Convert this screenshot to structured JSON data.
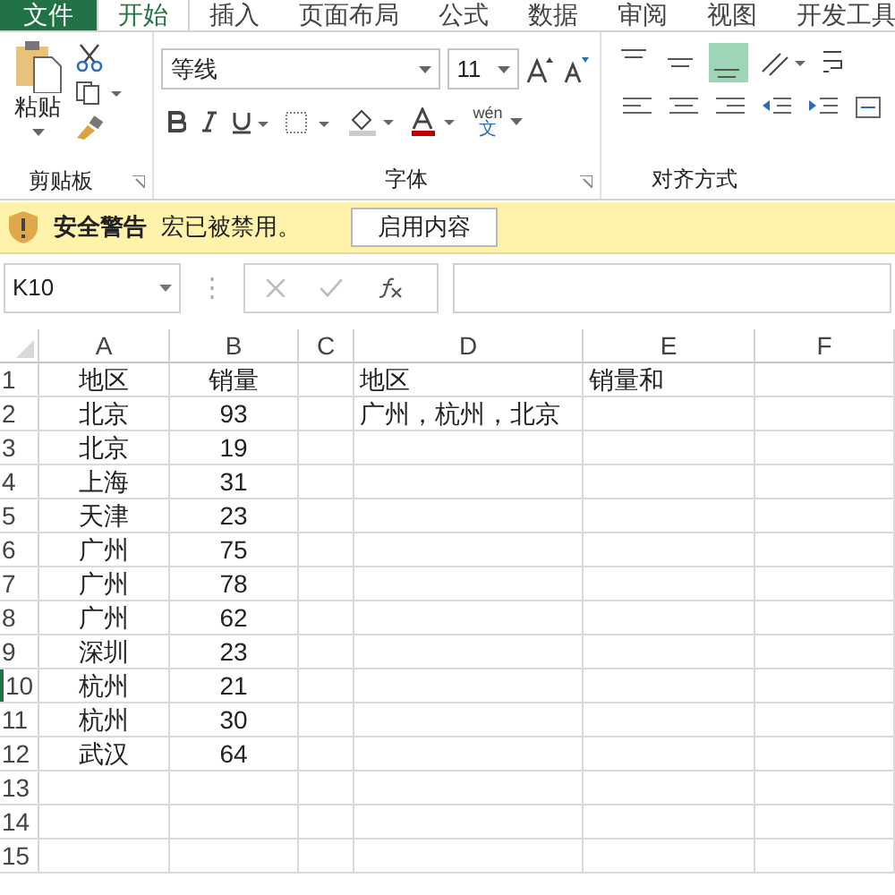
{
  "ribbon_tabs": [
    {
      "label": "文件",
      "selected": false,
      "kind": "file"
    },
    {
      "label": "开始",
      "selected": true,
      "kind": "tab"
    },
    {
      "label": "插入",
      "selected": false,
      "kind": "tab"
    },
    {
      "label": "页面布局",
      "selected": false,
      "kind": "tab"
    },
    {
      "label": "公式",
      "selected": false,
      "kind": "tab"
    },
    {
      "label": "数据",
      "selected": false,
      "kind": "tab"
    },
    {
      "label": "审阅",
      "selected": false,
      "kind": "tab"
    },
    {
      "label": "视图",
      "selected": false,
      "kind": "tab"
    },
    {
      "label": "开发工具",
      "selected": false,
      "kind": "tab"
    }
  ],
  "clipboard": {
    "paste_label": "粘贴",
    "group_label": "剪贴板"
  },
  "font": {
    "name": "等线",
    "size": "11",
    "phonetic_top": "wén",
    "phonetic_char": "文",
    "group_label": "字体"
  },
  "alignment": {
    "group_label": "对齐方式",
    "vertical": [
      {
        "selected": false
      },
      {
        "selected": false
      },
      {
        "selected": true
      }
    ]
  },
  "security_bar": {
    "title": "安全警告",
    "message": "宏已被禁用。",
    "button": "启用内容"
  },
  "formula_bar": {
    "name_box": "K10"
  },
  "sheet": {
    "columns": [
      "A",
      "B",
      "C",
      "D",
      "E",
      "F"
    ],
    "rows": [
      {
        "header": "1",
        "selected": false,
        "cells": {
          "a": "地区",
          "b": "销量",
          "d": "地区",
          "e": "销量和"
        }
      },
      {
        "header": "2",
        "selected": false,
        "cells": {
          "a": "北京",
          "b": "93",
          "d": "广州，杭州，北京"
        }
      },
      {
        "header": "3",
        "selected": false,
        "cells": {
          "a": "北京",
          "b": "19"
        }
      },
      {
        "header": "4",
        "selected": false,
        "cells": {
          "a": "上海",
          "b": "31"
        }
      },
      {
        "header": "5",
        "selected": false,
        "cells": {
          "a": "天津",
          "b": "23"
        }
      },
      {
        "header": "6",
        "selected": false,
        "cells": {
          "a": "广州",
          "b": "75"
        }
      },
      {
        "header": "7",
        "selected": false,
        "cells": {
          "a": "广州",
          "b": "78"
        }
      },
      {
        "header": "8",
        "selected": false,
        "cells": {
          "a": "广州",
          "b": "62"
        }
      },
      {
        "header": "9",
        "selected": false,
        "cells": {
          "a": "深圳",
          "b": "23"
        }
      },
      {
        "header": "10",
        "selected": true,
        "cells": {
          "a": "杭州",
          "b": "21"
        }
      },
      {
        "header": "11",
        "selected": false,
        "cells": {
          "a": "杭州",
          "b": "30"
        }
      },
      {
        "header": "12",
        "selected": false,
        "cells": {
          "a": "武汉",
          "b": "64"
        }
      },
      {
        "header": "13",
        "selected": false,
        "cells": {}
      },
      {
        "header": "14",
        "selected": false,
        "cells": {}
      },
      {
        "header": "15",
        "selected": false,
        "cells": {}
      }
    ]
  }
}
